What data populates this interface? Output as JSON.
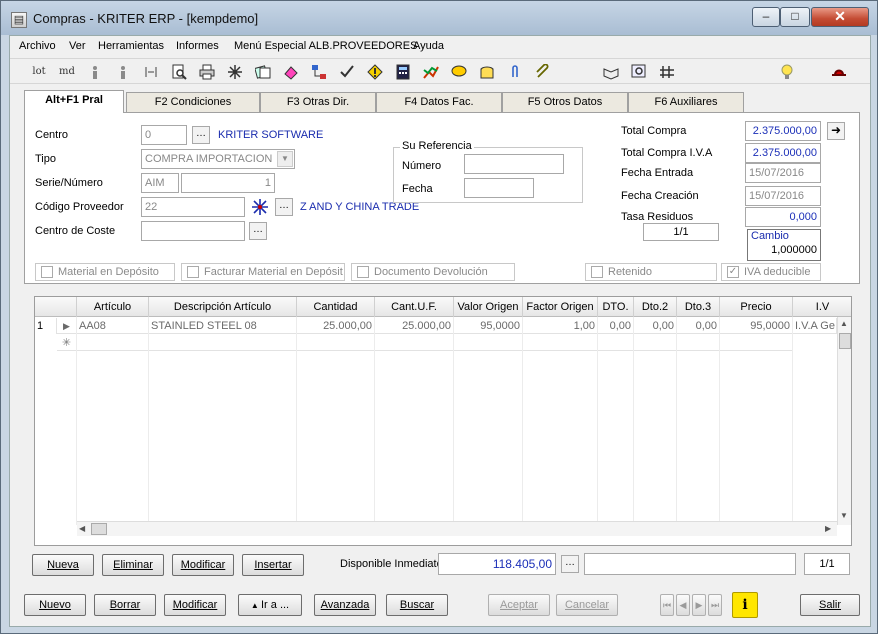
{
  "window": {
    "title": "Compras - KRITER ERP - [kempdemo]",
    "min": "–",
    "max": "□",
    "close": "✕"
  },
  "menu": [
    "Archivo",
    "Ver",
    "Herramientas",
    "Informes",
    "Menú Especial ALB.PROVEEDORES",
    "Ayuda"
  ],
  "toolbar": {
    "lot": "lot",
    "md": "md"
  },
  "tabs": [
    "Alt+F1 Pral",
    "F2 Condiciones",
    "F3 Otras Dir.",
    "F4 Datos Fac.",
    "F5 Otros Datos",
    "F6 Auxiliares"
  ],
  "form": {
    "centro_label": "Centro",
    "centro_value": "0",
    "centro_name": "KRITER SOFTWARE",
    "tipo_label": "Tipo",
    "tipo_value": "COMPRA IMPORTACION",
    "serie_label": "Serie/Número",
    "serie_value": "AIM",
    "numero_value": "1",
    "proveedor_label": "Código Proveedor",
    "proveedor_value": "22",
    "proveedor_name": "Z AND Y CHINA TRADE",
    "coste_label": "Centro de Coste",
    "coste_value": "",
    "ref_legend": "Su Referencia",
    "ref_numero_label": "Número",
    "ref_fecha_label": "Fecha",
    "ref_numero_value": "",
    "ref_fecha_value": "",
    "total_compra_label": "Total Compra",
    "total_compra_value": "2.375.000,00",
    "total_iva_label": "Total Compra I.V.A",
    "total_iva_value": "2.375.000,00",
    "fecha_entrada_label": "Fecha Entrada",
    "fecha_entrada_value": "15/07/2016",
    "fecha_creacion_label": "Fecha Creación",
    "fecha_creacion_value": "15/07/2016",
    "tasa_label": "Tasa Residuos",
    "tasa_value": "0,000",
    "tasa_page": "1/1",
    "cambio_label": "Cambio",
    "cambio_value": "1,000000",
    "checks": {
      "deposito": "Material en Depósito",
      "facturar": "Facturar Material en Depósit",
      "devolucion": "Documento Devolución",
      "retenido": "Retenido",
      "iva": "IVA deducible"
    }
  },
  "grid": {
    "columns": [
      "Artículo",
      "Descripción Artículo",
      "Cantidad",
      "Cant.U.F.",
      "Valor Origen",
      "Factor Origen",
      "DTO.",
      "Dto.2",
      "Dto.3",
      "Precio",
      "I.V"
    ],
    "rows": [
      {
        "n": "1",
        "articulo": "AA08",
        "descripcion": "STAINLED STEEL 08",
        "cantidad": "25.000,00",
        "cantuf": "25.000,00",
        "valor": "95,0000",
        "factor": "1,00",
        "dto": "0,00",
        "dto2": "0,00",
        "dto3": "0,00",
        "precio": "95,0000",
        "iva": "I.V.A Ge"
      }
    ]
  },
  "bottom": {
    "nueva": "Nueva",
    "eliminar": "Eliminar",
    "modificar": "Modificar",
    "insertar": "Insertar",
    "disponible_label": "Disponible Inmediato",
    "disponible_value": "118.405,00",
    "page": "1/1"
  },
  "footer": {
    "nuevo": "Nuevo",
    "borrar": "Borrar",
    "modificar": "Modificar",
    "ira": "Ir a ...",
    "avanzada": "Avanzada",
    "buscar": "Buscar",
    "aceptar": "Aceptar",
    "cancelar": "Cancelar",
    "salir": "Salir"
  }
}
